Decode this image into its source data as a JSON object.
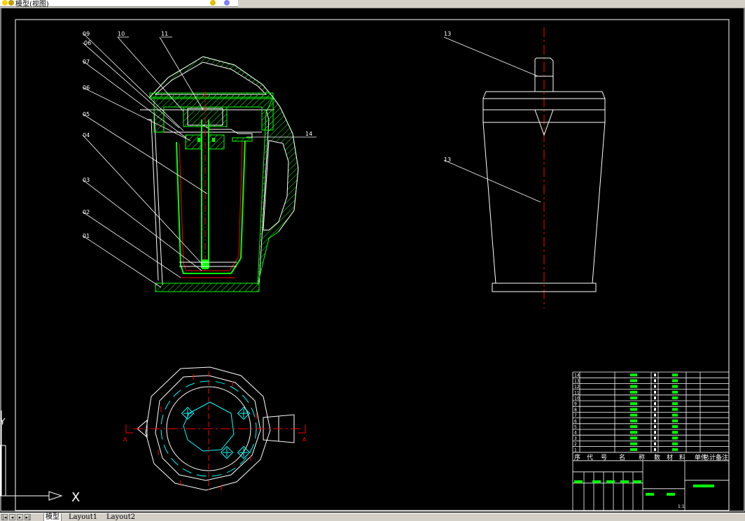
{
  "window": {
    "title_fragment": "模型(视图)"
  },
  "drawing": {
    "front_view_callouts": [
      "09",
      "06",
      "07",
      "06",
      "05",
      "04",
      "03",
      "02",
      "01",
      "10",
      "11",
      "14"
    ],
    "side_view_callouts": [
      "13",
      "13"
    ],
    "section_marks": [
      "A",
      "A"
    ],
    "ucs_labels": {
      "x": "X",
      "y": "Y"
    }
  },
  "title_block": {
    "bom_rows": [
      {
        "no": "14"
      },
      {
        "no": "13"
      },
      {
        "no": "12"
      },
      {
        "no": "11"
      },
      {
        "no": "10"
      },
      {
        "no": "9"
      },
      {
        "no": "8"
      },
      {
        "no": "7"
      },
      {
        "no": "6"
      },
      {
        "no": "5"
      },
      {
        "no": "4"
      },
      {
        "no": "3"
      },
      {
        "no": "2"
      },
      {
        "no": "1"
      }
    ],
    "header": [
      "序",
      "代",
      "号",
      "名",
      "称",
      "数",
      "材",
      "料",
      "单件",
      "总计",
      "备注"
    ],
    "scale": "1:1"
  },
  "tabs": {
    "items": [
      "模型",
      "Layout1",
      "Layout2"
    ],
    "active_index": 0
  },
  "colors": {
    "background": "#000000",
    "outline": "#ffffff",
    "green": "#00ff00",
    "red": "#ff0000",
    "cyan": "#00ffff",
    "toolbar": "#d4d0c8"
  }
}
